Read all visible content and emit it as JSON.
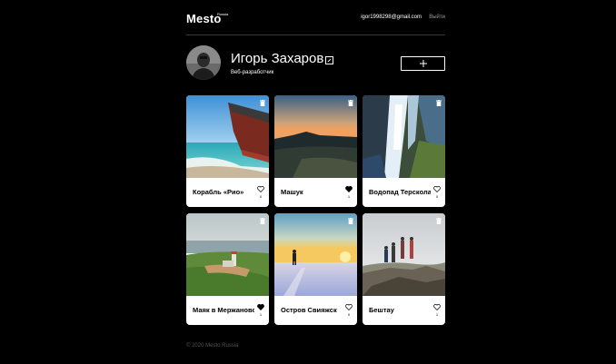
{
  "header": {
    "logo": "Mesto",
    "logo_sub": "Russia",
    "email": "igor1998298@gmail.com",
    "logout": "Выйти"
  },
  "profile": {
    "name": "Игорь Захаров",
    "job": "Веб-разработчик"
  },
  "cards": [
    {
      "title": "Корабль «Рио»",
      "likes": "0",
      "liked": false
    },
    {
      "title": "Машук",
      "likes": "1",
      "liked": true
    },
    {
      "title": "Водопад Терсколак",
      "likes": "0",
      "liked": false
    },
    {
      "title": "Маяк в Мержаново",
      "likes": "1",
      "liked": true
    },
    {
      "title": "Остров Свияжск",
      "likes": "0",
      "liked": false
    },
    {
      "title": "Бештау",
      "likes": "1",
      "liked": false
    }
  ],
  "footer": "© 2020 Mesto Russia",
  "icons": {
    "edit": "pencil-icon",
    "add": "plus-icon",
    "like": "heart-icon",
    "delete": "trash-icon"
  }
}
